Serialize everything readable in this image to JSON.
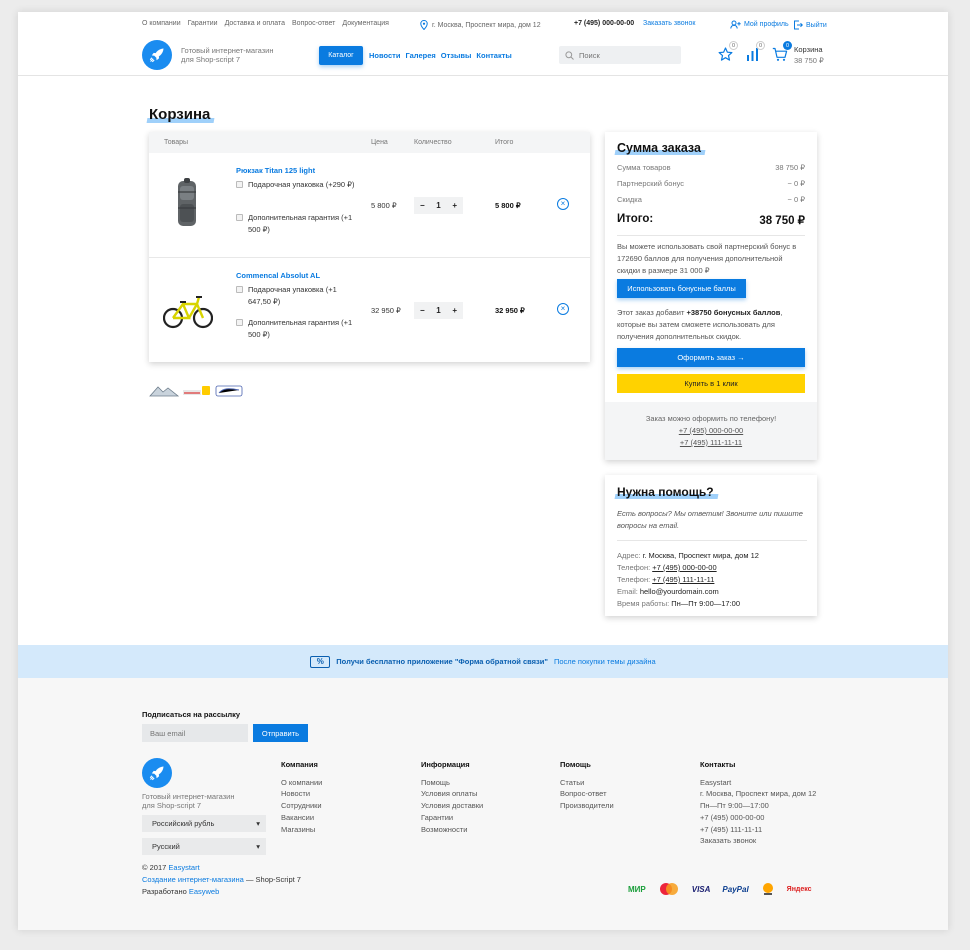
{
  "header": {
    "top_links": [
      "О компании",
      "Гарантии",
      "Доставка и оплата",
      "Вопрос-ответ",
      "Документация"
    ],
    "address": "г. Москва, Проспект мира, дом 12",
    "phone": "+7 (495) 000-00-00",
    "callback": "Заказать звонок",
    "profile": "Мой профиль",
    "logout": "Выйти",
    "logo_text_1": "Готовый интернет-магазин",
    "logo_text_2": "для Shop-script 7",
    "catalog": "Каталог",
    "nav": [
      "Новости",
      "Галерея",
      "Отзывы",
      "Контакты"
    ],
    "search_placeholder": "Поиск",
    "compare_count": "0",
    "favorites_count": "0",
    "cart_count": "0",
    "cart_label": "Корзина",
    "cart_sum": "38 750 ₽"
  },
  "page_title": "Корзина",
  "cart": {
    "columns": [
      "Товары",
      "Цена",
      "Количество",
      "Итого"
    ],
    "items": [
      {
        "name": "Рюкзак Titan 125 light",
        "options": [
          "Подарочная упаковка (+290 ₽)",
          "Дополнительная гарантия (+1 500 ₽)"
        ],
        "price": "5 800 ₽",
        "qty": "1",
        "total": "5 800 ₽"
      },
      {
        "name": "Commencal Absolut AL",
        "options": [
          "Подарочная упаковка (+1 647,50 ₽)",
          "Дополнительная гарантия (+1 500 ₽)"
        ],
        "price": "32 950 ₽",
        "qty": "1",
        "total": "32 950 ₽"
      }
    ],
    "minus": "−",
    "plus": "+",
    "remove": "×"
  },
  "summary": {
    "title": "Сумма заказа",
    "goods_label": "Сумма товаров",
    "goods_value": "38 750 ₽",
    "bonus_label": "Партнерский бонус",
    "bonus_value": "− 0 ₽",
    "discount_label": "Скидка",
    "discount_value": "− 0 ₽",
    "total_label": "Итого:",
    "total_value": "38 750 ₽",
    "bonus_note": "Вы можете использовать свой партнерский бонус в 172690 баллов для получения дополнительной скидки в размере 31 000 ₽",
    "bonus_button": "Использовать бонусные баллы",
    "earn_pre": "Этот заказ добавит ",
    "earn_bold": "+38750 бонусных баллов",
    "earn_post": ", которые вы затем сможете использовать для получения дополнительных скидок.",
    "order_button": "Оформить заказ →",
    "oneclick_button": "Купить в 1 клик",
    "phone_note": "Заказ можно оформить по телефону!",
    "phone_1": "+7 (495) 000-00-00",
    "phone_2": "+7 (495) 111-11-11"
  },
  "help": {
    "title": "Нужна помощь?",
    "intro": "Есть вопросы? Мы ответим! Звоните или пишите вопросы на email.",
    "address_label": "Адрес:",
    "address_value": "г. Москва, Проспект мира, дом 12",
    "phone_label": "Телефон:",
    "phone_1": "+7 (495) 000-00-00",
    "phone_2": "+7 (495) 111-11-11",
    "email_label": "Email:",
    "email_value": "hello@yourdomain.com",
    "hours_label": "Время работы:",
    "hours_value": "Пн—Пт 9:00—17:00"
  },
  "banner": {
    "icon": "%",
    "text": "Получи бесплатно приложение \"Форма обратной связи\"",
    "link": "После покупки темы дизайна"
  },
  "footer": {
    "newsletter_title": "Подписаться на рассылку",
    "email_placeholder": "Ваш email",
    "send": "Отправить",
    "logo_text_1": "Готовый интернет-магазин",
    "logo_text_2": "для Shop-script 7",
    "currency": "Российский рубль",
    "language": "Русский",
    "columns": [
      {
        "title": "Компания",
        "items": [
          "О компании",
          "Новости",
          "Сотрудники",
          "Вакансии",
          "Магазины"
        ]
      },
      {
        "title": "Информация",
        "items": [
          "Помощь",
          "Условия оплаты",
          "Условия доставки",
          "Гарантии",
          "Возможности"
        ]
      },
      {
        "title": "Помощь",
        "items": [
          "Статьи",
          "Вопрос-ответ",
          "Производители"
        ]
      },
      {
        "title": "Контакты",
        "items": [
          "Easystart",
          "г. Москва, Проспект мира, дом 12",
          "Пн—Пт 9:00—17:00",
          "+7 (495) 000-00-00",
          "+7 (495) 111-11-11",
          "Заказать звонок"
        ]
      }
    ],
    "copyright_pre": "© 2017 ",
    "copyright_link": "Easystart",
    "made_link": "Создание интернет-магазина",
    "made_post": " — Shop-Script 7",
    "dev_pre": "Разработано ",
    "dev_link": "Easyweb",
    "payment_logos": [
      "МИР",
      "VISA",
      "PayPal",
      "Яндекс"
    ]
  },
  "colors": {
    "accent": "#0a7be0",
    "yellow": "#ffd200",
    "banner": "#d4e9fb"
  }
}
